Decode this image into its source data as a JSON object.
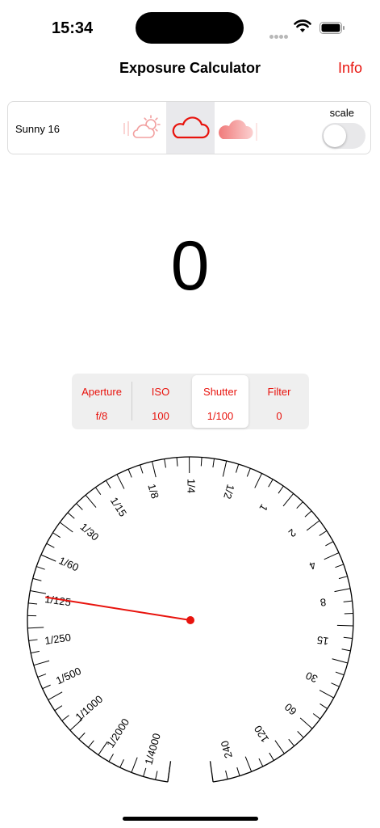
{
  "status": {
    "time": "15:34"
  },
  "nav": {
    "title": "Exposure Calculator",
    "info_label": "Info"
  },
  "weather": {
    "label": "Sunny 16",
    "scale_label": "scale",
    "scale_on": false,
    "selected": "overcast",
    "accent": "#e8130d"
  },
  "ev": {
    "value": "0"
  },
  "segments": [
    {
      "label": "Aperture",
      "value": "f/8",
      "selected": false
    },
    {
      "label": "ISO",
      "value": "100",
      "selected": false
    },
    {
      "label": "Shutter",
      "value": "1/100",
      "selected": true
    },
    {
      "label": "Filter",
      "value": "0",
      "selected": false
    }
  ],
  "dial": {
    "labels_left": [
      "1/4000",
      "1/2000",
      "1/1000",
      "1/500",
      "1/250",
      "1/125",
      "1/60",
      "1/30",
      "1/15",
      "1/8",
      "1/4"
    ],
    "labels_right": [
      "1/2",
      "1",
      "2",
      "4",
      "8",
      "15",
      "30",
      "60",
      "120",
      "240"
    ],
    "pointer_value": "1/100",
    "pointer_color": "#e8130d"
  }
}
